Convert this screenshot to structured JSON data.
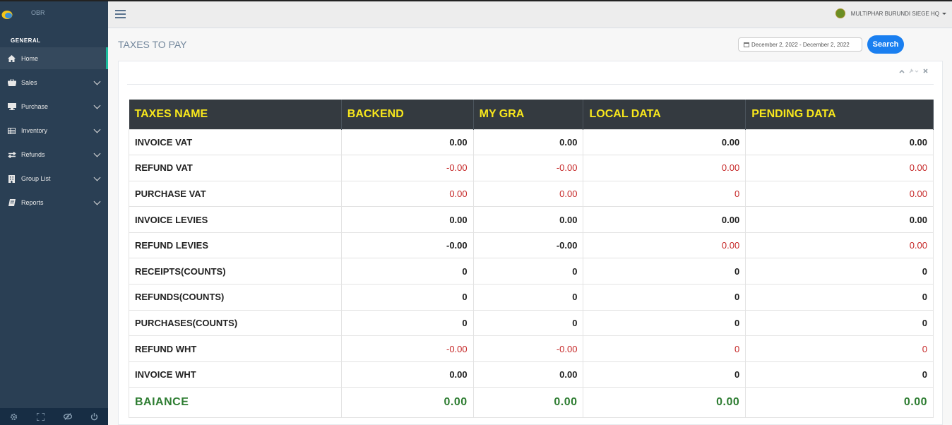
{
  "brand": {
    "name": "OBR"
  },
  "sidebar": {
    "section_title": "GENERAL",
    "items": [
      {
        "label": "Home",
        "icon": "home-icon",
        "active": true
      },
      {
        "label": "Sales",
        "icon": "basket-icon"
      },
      {
        "label": "Purchase",
        "icon": "desktop-icon"
      },
      {
        "label": "Inventory",
        "icon": "table-icon"
      },
      {
        "label": "Refunds",
        "icon": "exchange-icon"
      },
      {
        "label": "Group List",
        "icon": "building-icon"
      },
      {
        "label": "Reports",
        "icon": "book-icon"
      }
    ],
    "footer_icons": [
      "gear-icon",
      "fullscreen-icon",
      "eye-slash-icon",
      "power-icon"
    ]
  },
  "topnav": {
    "user_name": "MULTIPHAR BURUNDI SIEGE HQ"
  },
  "page": {
    "title": "TAXES TO PAY",
    "date_range": "December 2, 2022 - December 2, 2022",
    "search_label": "Search"
  },
  "table": {
    "headers": [
      "TAXES NAME",
      "BACKEND",
      "MY GRA",
      "LOCAL DATA",
      "PENDING DATA"
    ],
    "rows": [
      {
        "name": "INVOICE VAT",
        "values": [
          "0.00",
          "0.00",
          "0.00",
          "0.00"
        ],
        "neg": [
          false,
          false,
          false,
          false
        ]
      },
      {
        "name": "REFUND VAT",
        "values": [
          "-0.00",
          "-0.00",
          "0.00",
          "0.00"
        ],
        "neg": [
          true,
          true,
          true,
          true
        ]
      },
      {
        "name": "PURCHASE VAT",
        "values": [
          "0.00",
          "0.00",
          "0",
          "0.00"
        ],
        "neg": [
          true,
          true,
          true,
          true
        ]
      },
      {
        "name": "INVOICE LEVIES",
        "values": [
          "0.00",
          "0.00",
          "0.00",
          "0.00"
        ],
        "neg": [
          false,
          false,
          false,
          false
        ]
      },
      {
        "name": "REFUND LEVIES",
        "values": [
          "-0.00",
          "-0.00",
          "0.00",
          "0.00"
        ],
        "neg": [
          false,
          false,
          true,
          true
        ]
      },
      {
        "name": "RECEIPTS(COUNTS)",
        "values": [
          "0",
          "0",
          "0",
          "0"
        ],
        "neg": [
          false,
          false,
          false,
          false
        ]
      },
      {
        "name": "REFUNDS(COUNTS)",
        "values": [
          "0",
          "0",
          "0",
          "0"
        ],
        "neg": [
          false,
          false,
          false,
          false
        ]
      },
      {
        "name": "PURCHASES(COUNTS)",
        "values": [
          "0",
          "0",
          "0",
          "0"
        ],
        "neg": [
          false,
          false,
          false,
          false
        ]
      },
      {
        "name": "REFUND WHT",
        "values": [
          "-0.00",
          "-0.00",
          "0",
          "0"
        ],
        "neg": [
          true,
          true,
          true,
          true
        ]
      },
      {
        "name": "INVOICE WHT",
        "values": [
          "0.00",
          "0.00",
          "0",
          "0"
        ],
        "neg": [
          false,
          false,
          false,
          false
        ]
      }
    ],
    "balance": {
      "name": "BAIANCE",
      "values": [
        "0.00",
        "0.00",
        "0.00",
        "0.00"
      ]
    }
  },
  "colors": {
    "sidebar_bg": "#2a3f54",
    "header_bg": "#343a40",
    "header_text": "#f8e71c",
    "negative": "#c62828",
    "balance": "#2e7d32",
    "accent": "#1a7ff0"
  }
}
